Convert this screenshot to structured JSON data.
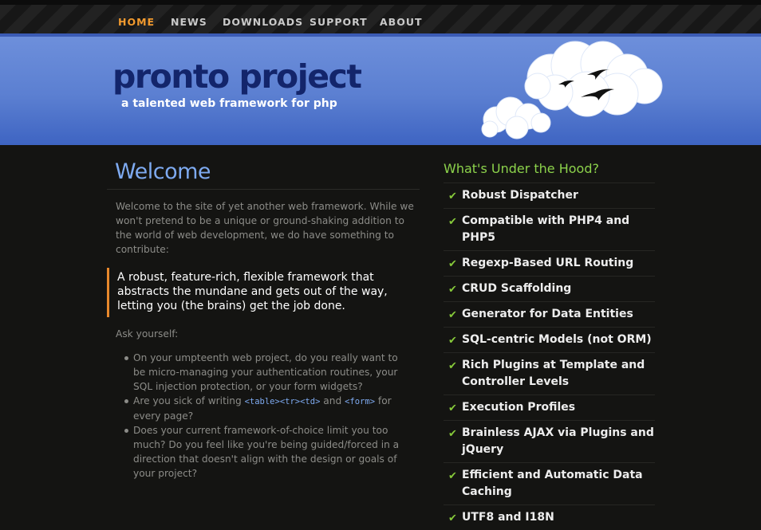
{
  "nav": {
    "items": [
      {
        "label": "HOME",
        "active": true
      },
      {
        "label": "NEWS",
        "active": false
      },
      {
        "label": "DOWNLOADS",
        "active": false
      },
      {
        "label": "SUPPORT",
        "active": false
      },
      {
        "label": "ABOUT",
        "active": false
      }
    ],
    "active_color": "#f29a2e"
  },
  "header": {
    "title": "pronto project",
    "tagline": "a talented web framework for php"
  },
  "main": {
    "title": "Welcome",
    "intro": "Welcome to the site of yet another web framework. While we won't pretend to be a unique or ground-shaking addition to the world of web development, we do have something to contribute:",
    "callout": "A robust, feature-rich, flexible framework that abstracts the mundane and gets out of the way, letting you (the brains) get the job done.",
    "ask": "Ask yourself:",
    "questions": {
      "q1": "On your umpteenth web project, do you really want to be micro-managing your authentication routines, your SQL injection protection, or your form widgets?",
      "q2_before": "Are you sick of writing ",
      "q2_code1": "<table><tr><td>",
      "q2_mid": " and ",
      "q2_code2": "<form>",
      "q2_after": " for every page?",
      "q3": "Does your current framework-of-choice limit you too much? Do you feel like you're being guided/forced in a direction that doesn't align with the design or goals of your project?"
    }
  },
  "side": {
    "title": "What's Under the Hood?",
    "check_icon": "check-icon",
    "features": [
      "Robust Dispatcher",
      "Compatible with PHP4 and PHP5",
      "Regexp-Based URL Routing",
      "CRUD Scaffolding",
      "Generator for Data Entities",
      "SQL-centric Models (not ORM)",
      "Rich Plugins at Template and Controller Levels",
      "Execution Profiles",
      "Brainless AJAX via Plugins and jQuery",
      "Efficient and Automatic Data Caching",
      "UTF8 and I18N"
    ]
  },
  "colors": {
    "accent_orange": "#e8882c",
    "link_blue": "#7eaaf0",
    "feature_green": "#8cd24b",
    "title_navy": "#13256b"
  }
}
